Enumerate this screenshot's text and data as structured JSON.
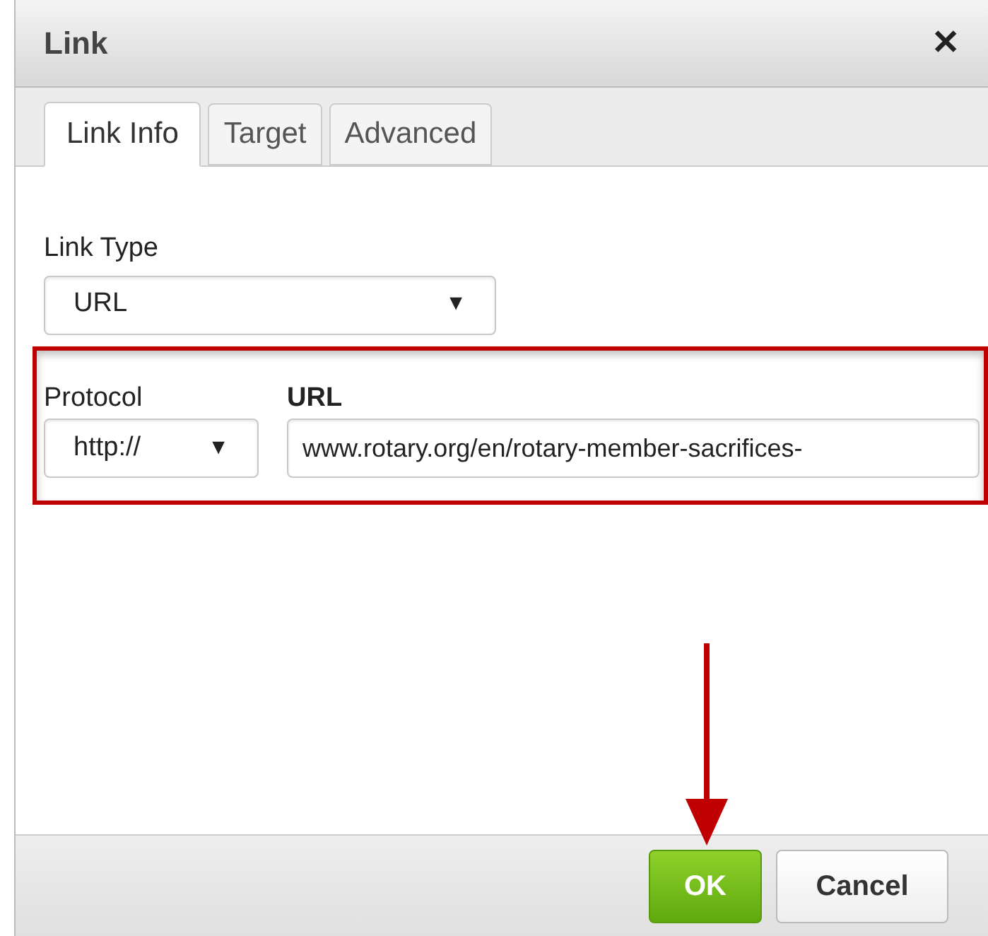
{
  "window": {
    "title": "Link",
    "close": "✕"
  },
  "tabs": [
    {
      "label": "Link Info",
      "selected": true
    },
    {
      "label": "Target",
      "selected": false
    },
    {
      "label": "Advanced",
      "selected": false
    }
  ],
  "link_type": {
    "label": "Link Type",
    "value": "URL",
    "caret": "▼"
  },
  "highlighted_row": {
    "highlighted": true,
    "protocol": {
      "label": "Protocol",
      "value": "http://",
      "caret": "▼"
    },
    "url": {
      "label": "URL",
      "value": "www.rotary.org/en/rotary-member-sacrifices-"
    }
  },
  "buttons": [
    {
      "label": "OK",
      "kind": "primary"
    },
    {
      "label": "Cancel",
      "kind": "secondary"
    }
  ]
}
